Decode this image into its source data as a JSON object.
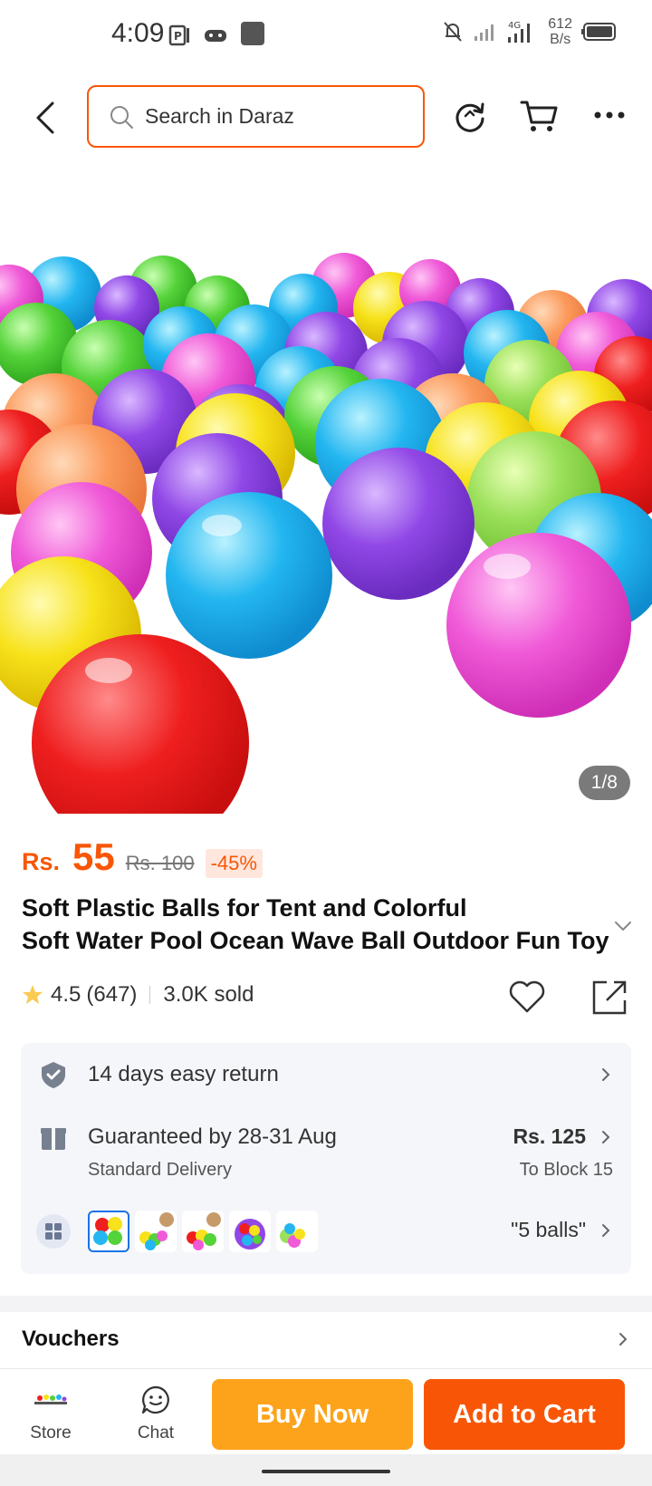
{
  "status_bar": {
    "time": "4:09",
    "net_speed_value": "612",
    "net_speed_unit": "B/s",
    "network_label": "4G"
  },
  "header": {
    "search_placeholder": "Search in Daraz"
  },
  "gallery": {
    "counter": "1/8",
    "image_alt": "colorful plastic balls"
  },
  "price": {
    "currency": "Rs.",
    "amount": "55",
    "original": "Rs. 100",
    "discount": "-45%"
  },
  "product": {
    "title_line1": "Soft Plastic Balls for Tent and Colorful",
    "title_line2": "Soft Water Pool Ocean Wave Ball Outdoor Fun Toy"
  },
  "rating": {
    "score": "4.5",
    "count": "(647)",
    "sold": "3.0K sold"
  },
  "services": {
    "return_label": "14 days easy return",
    "delivery_label": "Guaranteed by 28-31 Aug",
    "delivery_type": "Standard Delivery",
    "delivery_price": "Rs. 125",
    "delivery_location": "To Block 15",
    "variant_selected": "\"5 balls\""
  },
  "vouchers": {
    "label": "Vouchers"
  },
  "bottom_bar": {
    "store_label": "Store",
    "chat_label": "Chat",
    "buy_now_label": "Buy Now",
    "add_to_cart_label": "Add to Cart"
  },
  "colors": {
    "brand_orange": "#f85606",
    "buy_now_yellow": "#fda31b"
  }
}
